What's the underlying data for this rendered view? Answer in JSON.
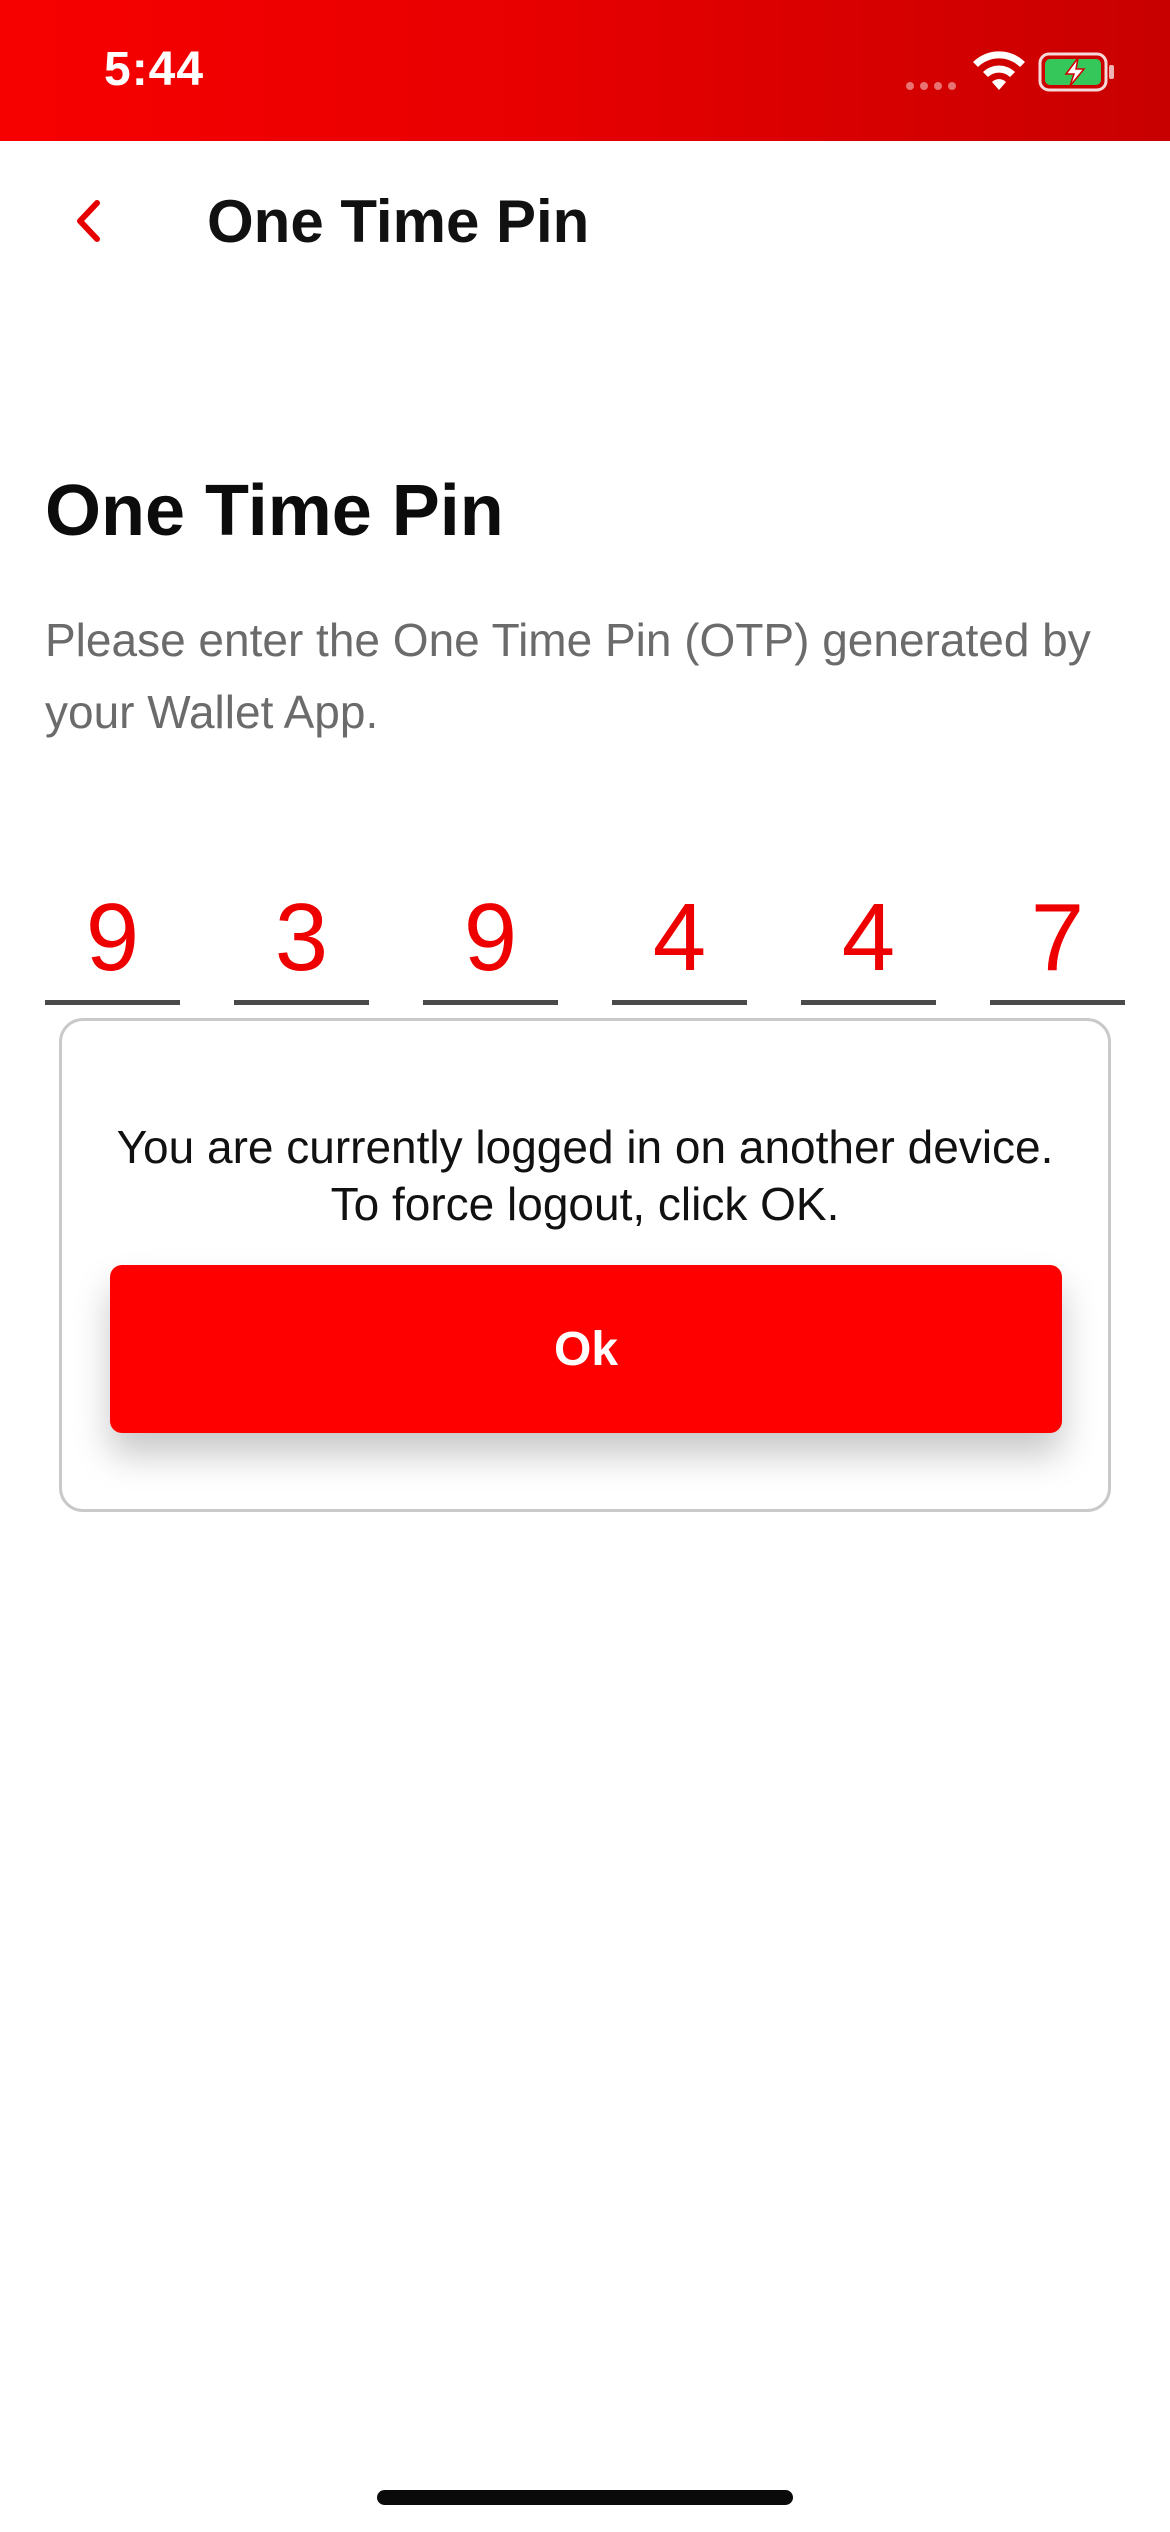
{
  "status_bar": {
    "time": "5:44",
    "icons": [
      "cellular-signal-icon",
      "wifi-icon",
      "battery-charging-icon"
    ],
    "background_color": "#e60000"
  },
  "nav": {
    "back_icon": "chevron-left-icon",
    "title": "One Time Pin"
  },
  "main": {
    "heading": "One Time Pin",
    "description": "Please enter the One Time Pin (OTP) generated by your Wallet App.",
    "otp_digits": [
      "9",
      "3",
      "9",
      "4",
      "4",
      "7"
    ]
  },
  "dialog": {
    "message": "You are currently logged in on another device. To force logout, click OK.",
    "ok_label": "Ok"
  },
  "colors": {
    "accent": "#ff0000",
    "digit": "#ee0000",
    "heading": "#0c0c0c",
    "muted_text": "#6b6b6b"
  }
}
